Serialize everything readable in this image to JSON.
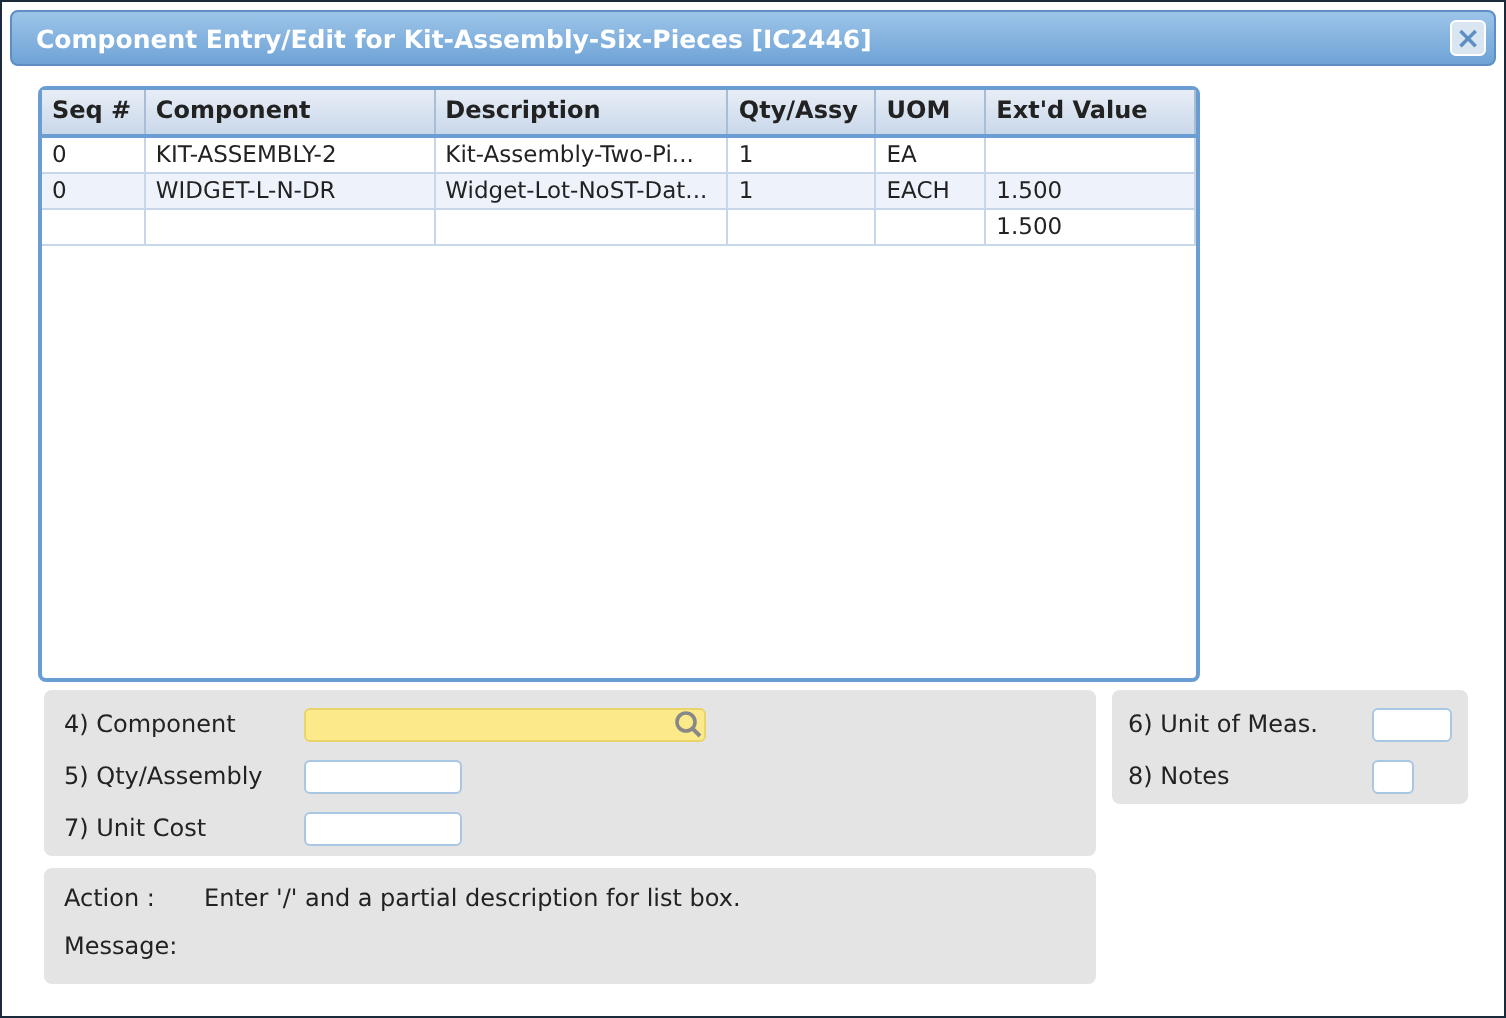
{
  "window": {
    "title": "Component Entry/Edit for Kit-Assembly-Six-Pieces [IC2446]",
    "close": "×"
  },
  "table": {
    "columns": [
      "Seq #",
      "Component",
      "Description",
      "Qty/Assy",
      "UOM",
      "Ext'd Value"
    ],
    "rows": [
      {
        "cells": [
          "0",
          "KIT-ASSEMBLY-2",
          "Kit-Assembly-Two-Pi...",
          "1",
          "EA",
          null
        ]
      },
      {
        "cells": [
          "0",
          "WIDGET-L-N-DR",
          "Widget-Lot-NoST-Dat...",
          "1",
          "EACH",
          "1.500"
        ]
      },
      {
        "cells": [
          null,
          null,
          null,
          null,
          null,
          "1.500"
        ]
      }
    ]
  },
  "form_left": [
    {
      "label": "4) Component",
      "kind": "lookup",
      "focused": true
    },
    {
      "label": "5) Qty/Assembly",
      "kind": "text",
      "focused": false
    },
    {
      "label": "7) Unit Cost",
      "kind": "text",
      "focused": false
    }
  ],
  "form_right": [
    {
      "label": "6) Unit of Meas.",
      "kind": "text",
      "focused": false
    },
    {
      "label": "8) Notes",
      "kind": "small",
      "focused": false
    }
  ],
  "status": {
    "action_label": "Action :",
    "action_text": "Enter '/' and a partial description for list box.",
    "message_label": "Message:"
  }
}
